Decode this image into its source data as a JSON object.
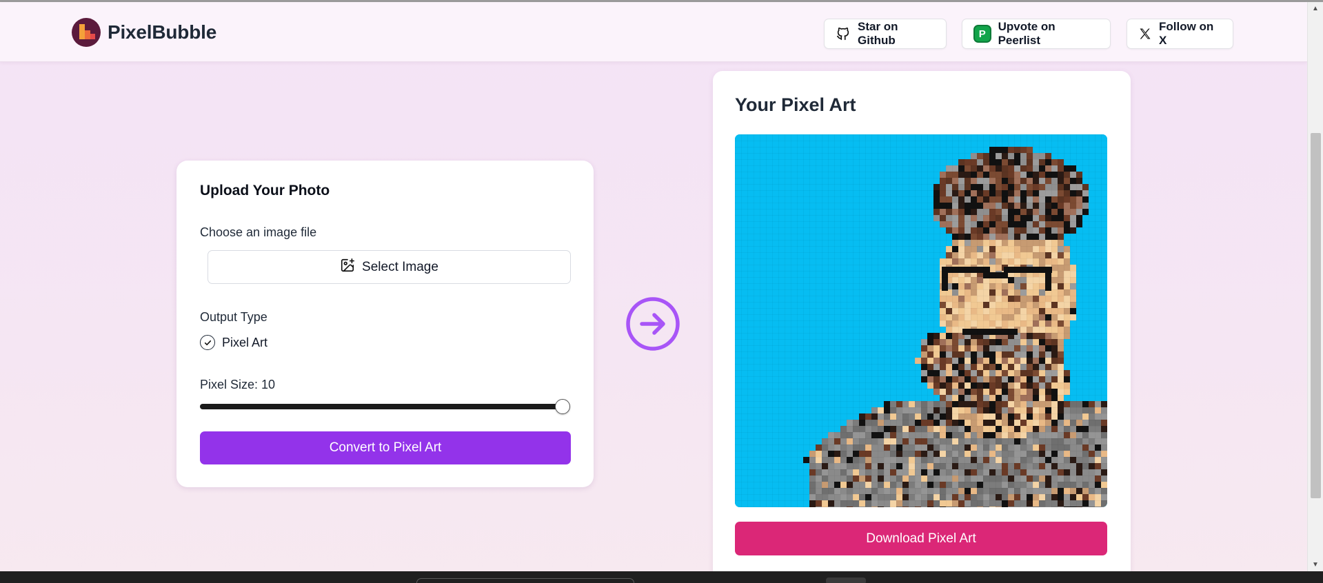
{
  "brand": {
    "name": "PixelBubble"
  },
  "header": {
    "github_label": "Star on Github",
    "peerlist_label": "Upvote on Peerlist",
    "peerlist_icon_letter": "P",
    "x_label": "Follow on X"
  },
  "upload": {
    "title": "Upload Your Photo",
    "file_label": "Choose an image file",
    "select_label": "Select Image",
    "output_type_label": "Output Type",
    "output_option": "Pixel Art",
    "output_selected": true,
    "pixel_size_label": "Pixel Size: 10",
    "pixel_size_value": 10,
    "convert_label": "Convert to Pixel Art"
  },
  "result": {
    "title": "Your Pixel Art",
    "download_label": "Download Pixel Art"
  },
  "colors": {
    "accent_purple": "#9333ea",
    "download_pink": "#db2777",
    "pixel_background": "#06bdf2"
  }
}
